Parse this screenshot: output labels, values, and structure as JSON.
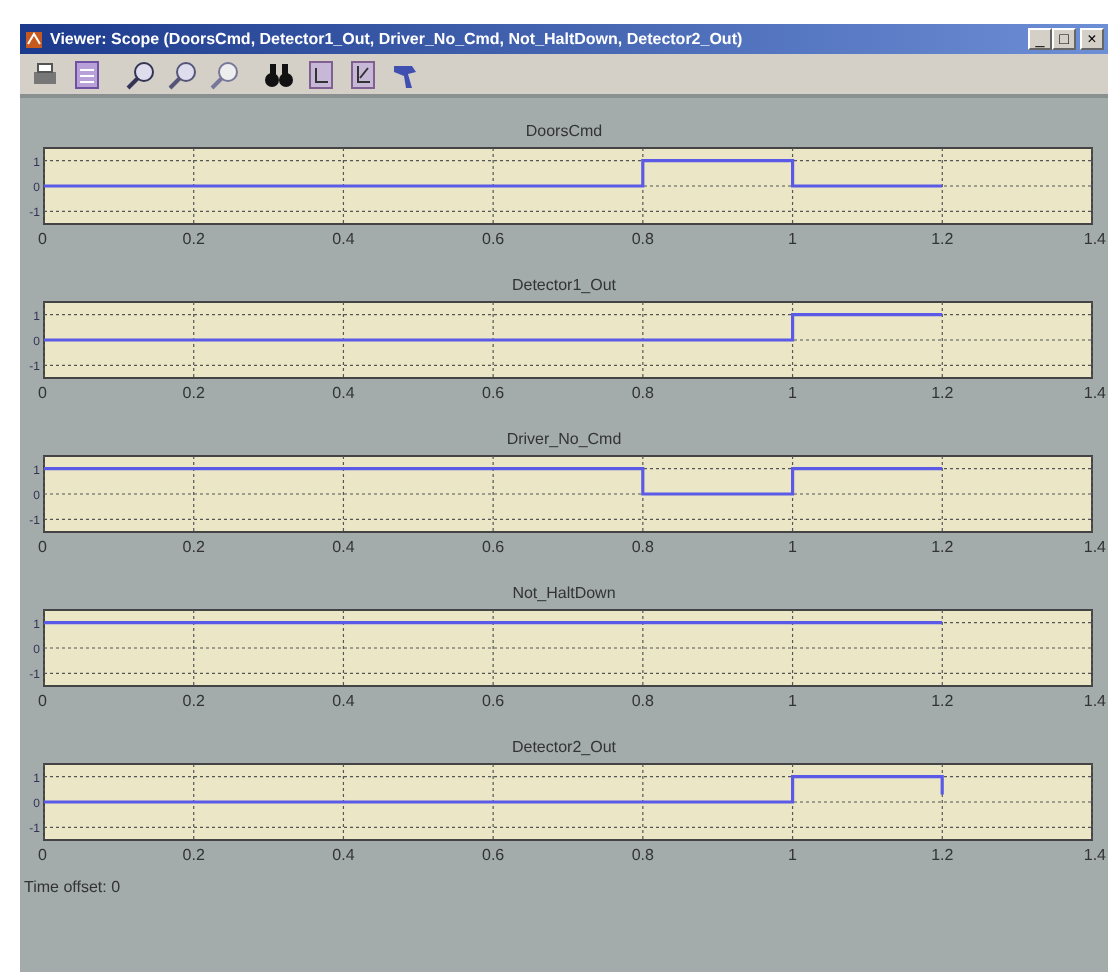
{
  "window": {
    "title": "Viewer: Scope (DoorsCmd, Detector1_Out, Driver_No_Cmd, Not_HaltDown, Detector2_Out)",
    "controls": [
      "_",
      "□",
      "×"
    ]
  },
  "toolbar": {
    "tools": [
      {
        "kind": "print"
      },
      {
        "kind": "parameters"
      },
      {
        "kind": "zoom"
      },
      {
        "kind": "zoom-x"
      },
      {
        "kind": "zoom-y"
      },
      {
        "kind": "autoscale"
      },
      {
        "kind": "save-axes"
      },
      {
        "kind": "restore-axes"
      },
      {
        "kind": "pointer"
      }
    ]
  },
  "plots": [
    {
      "chart_data": {
        "type": "line",
        "title": "DoorsCmd",
        "x": [
          0,
          0.8,
          0.8,
          1,
          1,
          1.2
        ],
        "series": [
          {
            "color": "#5a5ae6",
            "values": [
              0,
              0,
              1,
              1,
              0,
              0
            ]
          }
        ],
        "xlim": [
          0,
          1.4
        ],
        "ylim": [
          -1.5,
          1.5
        ],
        "xticks": [
          0,
          0.2,
          0.4,
          0.6,
          0.8,
          1,
          1.2,
          1.4
        ],
        "yticks": [
          -1,
          0,
          1
        ],
        "grid": true
      }
    },
    {
      "chart_data": {
        "type": "line",
        "title": "Detector1_Out",
        "x": [
          0,
          1,
          1,
          1.2
        ],
        "series": [
          {
            "color": "#5a5ae6",
            "values": [
              0,
              0,
              1,
              1
            ]
          }
        ],
        "xlim": [
          0,
          1.4
        ],
        "ylim": [
          -1.5,
          1.5
        ],
        "xticks": [
          0,
          0.2,
          0.4,
          0.6,
          0.8,
          1,
          1.2,
          1.4
        ],
        "yticks": [
          -1,
          0,
          1
        ],
        "grid": true
      }
    },
    {
      "chart_data": {
        "type": "line",
        "title": "Driver_No_Cmd",
        "x": [
          0,
          0.8,
          0.8,
          1,
          1,
          1.2
        ],
        "series": [
          {
            "color": "#5a5ae6",
            "values": [
              1,
              1,
              0,
              0,
              1,
              1
            ]
          }
        ],
        "xlim": [
          0,
          1.4
        ],
        "ylim": [
          -1.5,
          1.5
        ],
        "xticks": [
          0,
          0.2,
          0.4,
          0.6,
          0.8,
          1,
          1.2,
          1.4
        ],
        "yticks": [
          -1,
          0,
          1
        ],
        "grid": true
      }
    },
    {
      "chart_data": {
        "type": "line",
        "title": "Not_HaltDown",
        "x": [
          0,
          1.2
        ],
        "series": [
          {
            "color": "#5a5ae6",
            "values": [
              1,
              1
            ]
          }
        ],
        "xlim": [
          0,
          1.4
        ],
        "ylim": [
          -1.5,
          1.5
        ],
        "xticks": [
          0,
          0.2,
          0.4,
          0.6,
          0.8,
          1,
          1.2,
          1.4
        ],
        "yticks": [
          -1,
          0,
          1
        ],
        "grid": true
      }
    },
    {
      "chart_data": {
        "type": "line",
        "title": "Detector2_Out",
        "x": [
          0,
          1,
          1,
          1.2,
          1.2
        ],
        "series": [
          {
            "color": "#5a5ae6",
            "values": [
              0,
              0,
              1,
              1,
              0.3
            ]
          }
        ],
        "xlim": [
          0,
          1.4
        ],
        "ylim": [
          -1.5,
          1.5
        ],
        "xticks": [
          0,
          0.2,
          0.4,
          0.6,
          0.8,
          1,
          1.2,
          1.4
        ],
        "yticks": [
          -1,
          0,
          1
        ],
        "grid": true
      }
    }
  ],
  "status_bar": {
    "text": "Time offset:  0"
  }
}
